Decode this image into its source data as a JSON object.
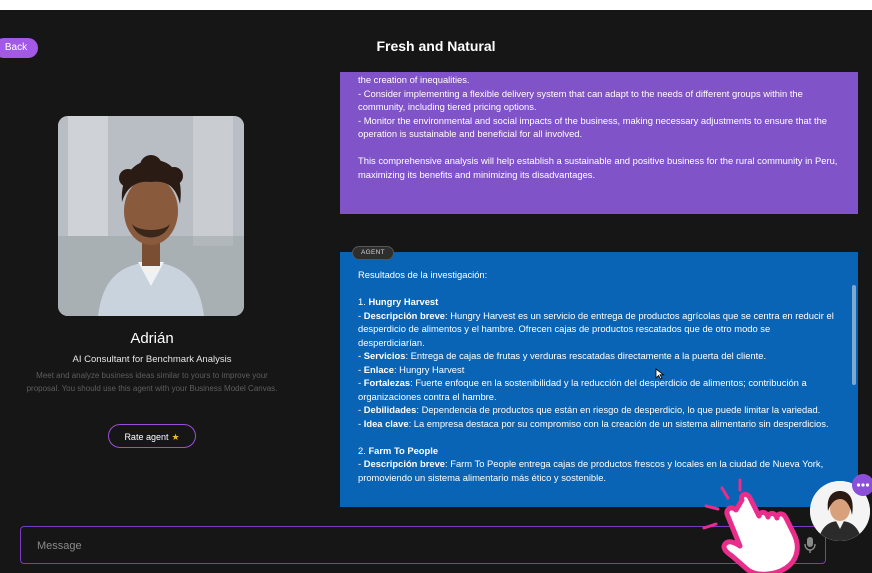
{
  "header": {
    "back_label": "Back",
    "title": "Fresh and Natural"
  },
  "agent": {
    "name": "Adrián",
    "role": "AI Consultant for Benchmark Analysis",
    "description": "Meet and analyze business ideas similar to yours to improve your proposal. You should use this agent with your Business Model Canvas.",
    "rate_label": "Rate agent"
  },
  "messages": {
    "previous": {
      "lines": [
        "the creation of inequalities.",
        "- Consider implementing a flexible delivery system that can adapt to the needs of different groups within the community, including tiered pricing options.",
        "- Monitor the environmental and social impacts of the business, making necessary adjustments to ensure that the operation is sustainable and beneficial for all involved."
      ],
      "closing": "This comprehensive analysis will help establish a sustainable and positive business for the rural community in Peru, maximizing its benefits and minimizing its disadvantages."
    },
    "agent_tag": "AGENT",
    "current": {
      "intro": "Resultados de la investigación:",
      "item1_number": "1.",
      "item1_name": "Hungry Harvest",
      "desc_label": "Descripción breve",
      "desc_text": ": Hungry Harvest es un servicio de entrega de productos agrícolas que se centra en reducir el desperdicio de alimentos y el hambre. Ofrecen cajas de productos rescatados que de otro modo se desperdiciarían.",
      "services_label": "Servicios",
      "services_text": ": Entrega de cajas de frutas y verduras rescatadas directamente a la puerta del cliente.",
      "link_label": "Enlace",
      "link_text": ": Hungry Harvest",
      "strengths_label": "Fortalezas",
      "strengths_text": ": Fuerte enfoque en la sostenibilidad y la reducción del desperdicio de alimentos; contribución a organizaciones contra el hambre.",
      "weak_label": "Debilidades",
      "weak_text": ": Dependencia de productos que están en riesgo de desperdicio, lo que puede limitar la variedad.",
      "key_label": "Idea clave",
      "key_text": ": La empresa destaca por su compromiso con la creación de un sistema alimentario sin desperdicios.",
      "item2_number": "2.",
      "item2_name": "Farm To People",
      "desc2_label": "Descripción breve",
      "desc2_text": ": Farm To People entrega cajas de productos frescos y locales en la ciudad de Nueva York, promoviendo un sistema alimentario más ético y sostenible."
    }
  },
  "composer": {
    "placeholder": "Message"
  },
  "icons": {
    "mic": "microphone-icon",
    "star": "star-icon",
    "chat": "chat-bubble-icon",
    "hand": "tap-hand-icon"
  },
  "colors": {
    "background": "#161616",
    "accent_purple": "#8053c8",
    "agent_blue": "#0a64b6",
    "back_button": "#a259e6",
    "hand_pink": "#e82d8a"
  }
}
